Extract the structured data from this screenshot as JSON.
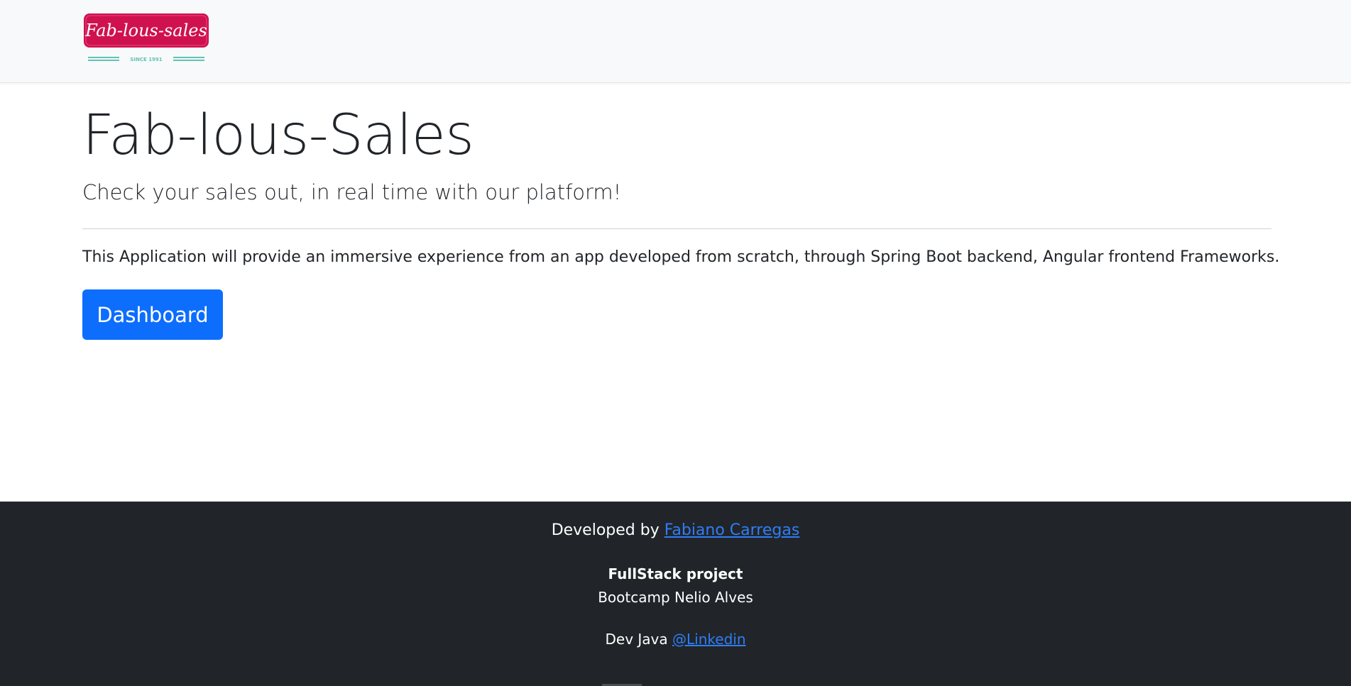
{
  "navbar": {
    "logo": {
      "text": "Fab-lous-sales",
      "tagline": "SINCE 1991",
      "badge_color": "#d0114f",
      "stripe_color": "#5ec4b6"
    }
  },
  "main": {
    "title": "Fab-lous-Sales",
    "lead": "Check your sales out, in real time with our platform!",
    "description": "This Application will provide an immersive experience from an app developed from scratch, through Spring Boot backend, Angular frontend Frameworks.",
    "dashboard_button": "Dashboard"
  },
  "footer": {
    "developed_by_prefix": "Developed by ",
    "developer_link": "Fabiano Carregas",
    "project_title": "FullStack project",
    "bootcamp": "Bootcamp Nelio Alves",
    "dev_prefix": "Dev Java ",
    "linkedin_link": "@Linkedin"
  },
  "colors": {
    "navbar_bg": "#f8f9fa",
    "primary": "#0d6efd",
    "footer_bg": "#212529",
    "link": "#2f7df6"
  }
}
